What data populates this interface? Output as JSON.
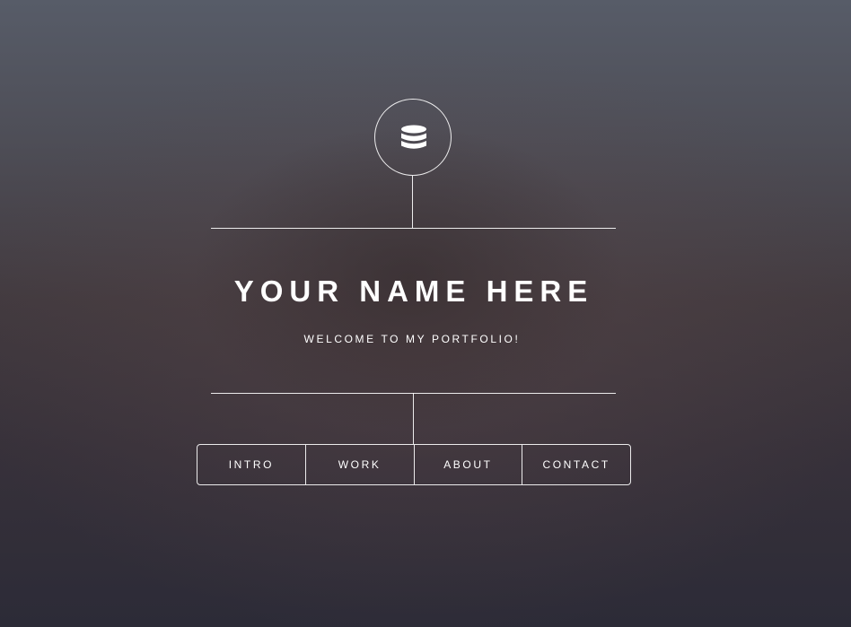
{
  "header": {
    "logo_icon": "database-icon"
  },
  "main": {
    "name": "YOUR NAME HERE",
    "tagline": "WELCOME TO MY PORTFOLIO!"
  },
  "nav": {
    "items": [
      {
        "label": "INTRO"
      },
      {
        "label": "WORK"
      },
      {
        "label": "ABOUT"
      },
      {
        "label": "CONTACT"
      }
    ]
  },
  "colors": {
    "foreground": "#ffffff",
    "background_top": "#575c68",
    "background_bottom": "#2c2b37"
  }
}
